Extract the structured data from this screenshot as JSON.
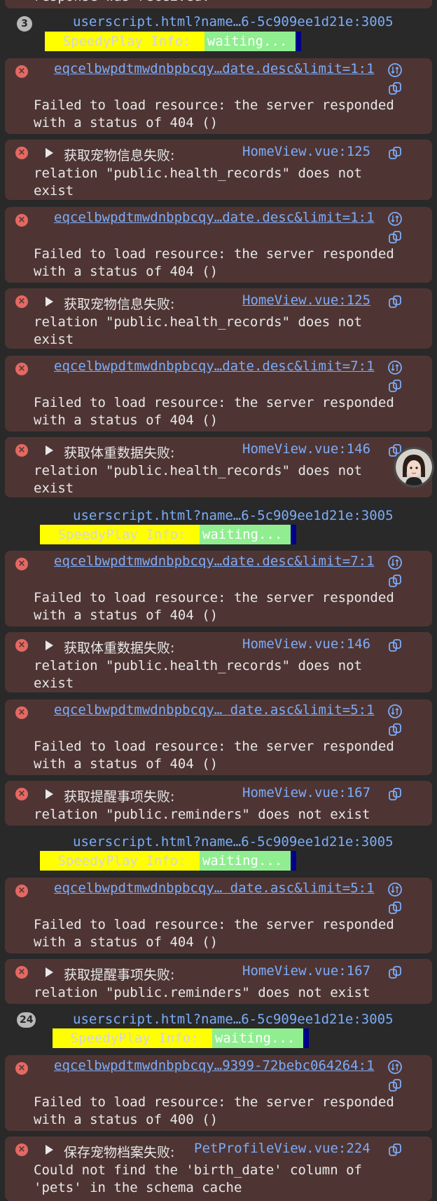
{
  "top": {
    "partial": "response was received."
  },
  "groups": [
    {
      "count": "3",
      "source": "userscript.html?name…6-5c909ee1d21e:3005",
      "speedy_label": " SpeedyPlay Info: ",
      "speedy_value": "waiting..."
    },
    {
      "count": "",
      "source": "userscript.html?name…6-5c909ee1d21e:3005",
      "speedy_label": " SpeedyPlay Info: ",
      "speedy_value": "waiting..."
    },
    {
      "count": "",
      "source": "userscript.html?name…6-5c909ee1d21e:3005",
      "speedy_label": " SpeedyPlay Info: ",
      "speedy_value": "waiting..."
    },
    {
      "count": "24",
      "source": "userscript.html?name…6-5c909ee1d21e:3005",
      "speedy_label": " SpeedyPlay Info: ",
      "speedy_value": "waiting..."
    }
  ],
  "entries": [
    {
      "url": "eqcelbwpdtmwdnbpbcqy…date.desc&limit=1:1",
      "line1": "Failed to load resource: the server responded",
      "line2": "with a status of 404 ()"
    },
    {
      "title": "获取宠物信息失败:",
      "source": "HomeView.vue:125",
      "line1": "relation \"public.health_records\" does not",
      "line2": "exist"
    },
    {
      "url": "eqcelbwpdtmwdnbpbcqy…date.desc&limit=1:1",
      "line1": "Failed to load resource: the server responded",
      "line2": "with a status of 404 ()"
    },
    {
      "title": "获取宠物信息失败:",
      "source": "HomeView.vue:125",
      "line1": "relation \"public.health_records\" does not",
      "line2": "exist"
    },
    {
      "url": "eqcelbwpdtmwdnbpbcqy…date.desc&limit=7:1",
      "line1": "Failed to load resource: the server responded",
      "line2": "with a status of 404 ()"
    },
    {
      "title": "获取体重数据失败:",
      "source": "HomeView.vue:146",
      "line1": "relation \"public.health_records\" does not",
      "line2": "exist"
    },
    {
      "url": "eqcelbwpdtmwdnbpbcqy…date.desc&limit=7:1",
      "line1": "Failed to load resource: the server responded",
      "line2": "with a status of 404 ()"
    },
    {
      "title": "获取体重数据失败:",
      "source": "HomeView.vue:146",
      "line1": "relation \"public.health_records\" does not",
      "line2": "exist"
    },
    {
      "url": "eqcelbwpdtmwdnbpbcqy… date.asc&limit=5:1",
      "line1": "Failed to load resource: the server responded",
      "line2": "with a status of 404 ()"
    },
    {
      "title": "获取提醒事项失败:",
      "source": "HomeView.vue:167",
      "line1": "relation \"public.reminders\" does not exist"
    },
    {
      "url": "eqcelbwpdtmwdnbpbcqy… date.asc&limit=5:1",
      "line1": "Failed to load resource: the server responded",
      "line2": "with a status of 404 ()"
    },
    {
      "title": "获取提醒事项失败:",
      "source": "HomeView.vue:167",
      "line1": "relation \"public.reminders\" does not exist"
    },
    {
      "url": "eqcelbwpdtmwdnbpbcqy…9399-72bebc064264:1",
      "line1": "Failed to load resource: the server responded",
      "line2": "with a status of 400 ()"
    },
    {
      "title": "保存宠物档案失败:",
      "source": "PetProfileView.vue:224",
      "line1": "Could not find the 'birth_date' column of",
      "line2": "'pets' in the schema cache"
    }
  ]
}
